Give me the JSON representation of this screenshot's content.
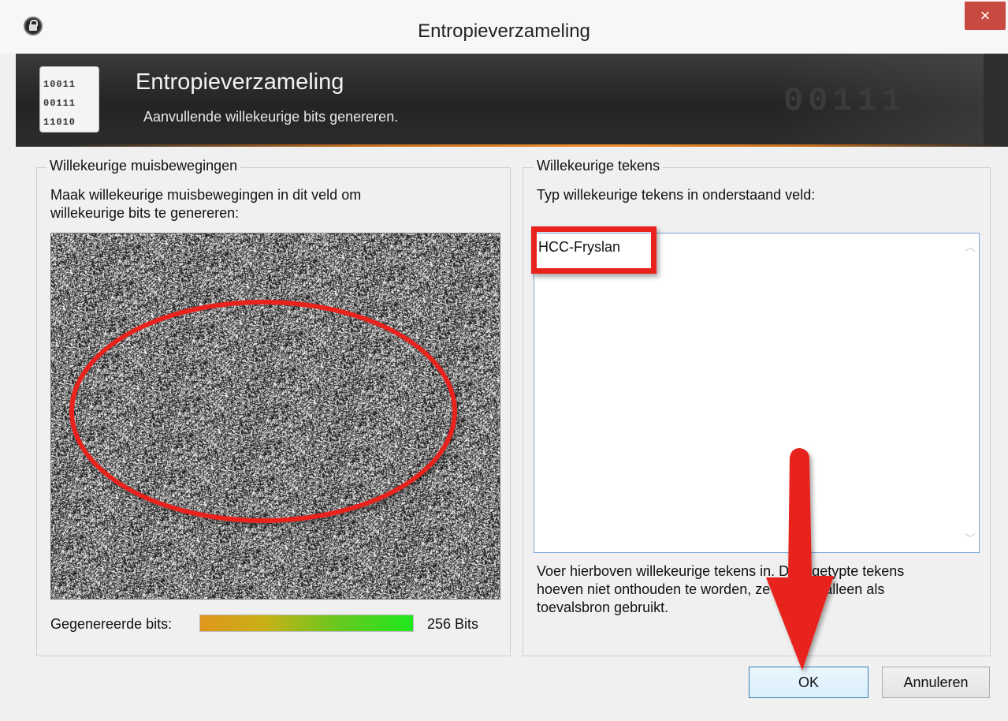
{
  "window": {
    "title": "Entropieverzameling",
    "close_label": "×"
  },
  "banner": {
    "title": "Entropieverzameling",
    "subtitle": "Aanvullende willekeurige bits genereren.",
    "icon_lines": [
      "10011",
      "00111",
      "11010"
    ],
    "watermark": "00111"
  },
  "mouse_group": {
    "legend": "Willekeurige muisbewegingen",
    "instruction_line1": "Maak willekeurige muisbewegingen in dit veld om",
    "instruction_line2": "willekeurige bits te genereren:",
    "bits_label": "Gegenereerde bits:",
    "bits_value": "256 Bits",
    "progress_fraction": 1.0
  },
  "keys_group": {
    "legend": "Willekeurige tekens",
    "instruction": "Typ willekeurige tekens in onderstaand veld:",
    "input_value": "HCC-Fryslan",
    "hint_line1": "Voer hierboven willekeurige tekens in. De ingetypte tekens",
    "hint_line2": "hoeven niet onthouden te worden, ze worden alleen als",
    "hint_line3": "toevalsbron gebruikt."
  },
  "buttons": {
    "ok": "OK",
    "cancel": "Annuleren"
  },
  "colors": {
    "annotation_red": "#e8231e",
    "banner_accent": "#ee8b2a",
    "close_red": "#c7493f"
  }
}
